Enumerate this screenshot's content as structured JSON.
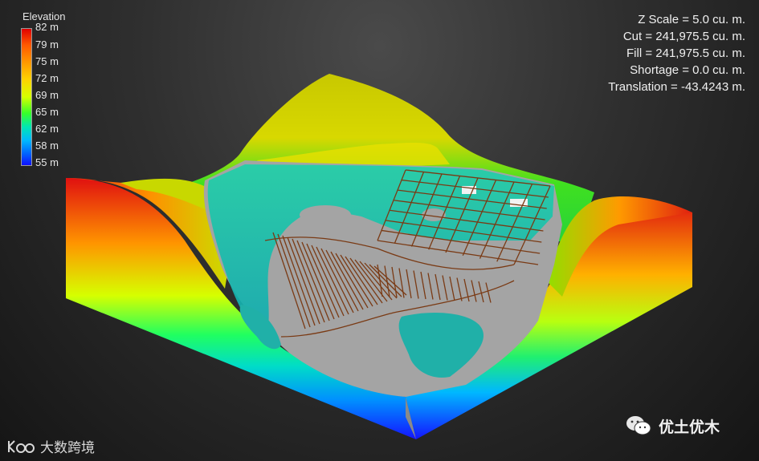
{
  "legend": {
    "title": "Elevation",
    "labels": [
      "82 m",
      "79 m",
      "75 m",
      "72 m",
      "69 m",
      "65 m",
      "62 m",
      "58 m",
      "55 m"
    ]
  },
  "stats": {
    "z_scale": "Z Scale = 5.0 cu. m.",
    "cut": "Cut = 241,975.5 cu. m.",
    "fill": "Fill = 241,975.5 cu. m.",
    "shortage": "Shortage = 0.0 cu. m.",
    "translation": "Translation = -43.4243 m."
  },
  "watermarks": {
    "left": "大数跨境",
    "right": "优土优木"
  },
  "colors": {
    "high": "#e00000",
    "mid": "#d6ff00",
    "low": "#1010ff",
    "cut_surface": "#9c9c9c",
    "fill_water": "#22b8a8",
    "design_lines": "#7a3a14"
  },
  "icons": {
    "logo_left": "kb-logo-icon",
    "logo_right": "wechat-icon"
  }
}
